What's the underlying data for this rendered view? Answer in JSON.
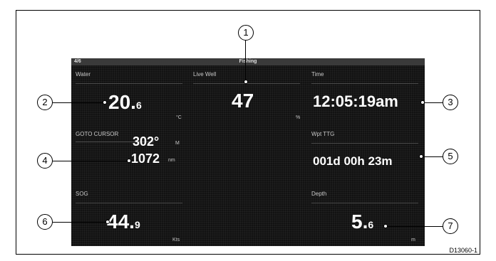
{
  "header": {
    "page_indicator": "4/6",
    "title": "Fishing"
  },
  "panels": {
    "water": {
      "label": "Water",
      "value": "20.",
      "decimal": "6",
      "unit": "°C"
    },
    "live_well": {
      "label": "Live Well",
      "value": "47",
      "unit": "%"
    },
    "time": {
      "label": "Time",
      "value": "12:05:19am"
    },
    "goto_cursor": {
      "label": "GOTO CURSOR",
      "bearing": "302°",
      "bearing_unit": "M",
      "distance": "1072",
      "distance_unit": "nm"
    },
    "wpt_ttg": {
      "label": "Wpt TTG",
      "value": "001d 00h 23m"
    },
    "sog": {
      "label": "SOG",
      "value": "44.",
      "decimal": "9",
      "unit": "Kts"
    },
    "depth": {
      "label": "Depth",
      "value": "5.",
      "decimal": "6",
      "unit": "m"
    }
  },
  "callouts": [
    "1",
    "2",
    "3",
    "4",
    "5",
    "6",
    "7"
  ],
  "document_id": "D13060-1"
}
